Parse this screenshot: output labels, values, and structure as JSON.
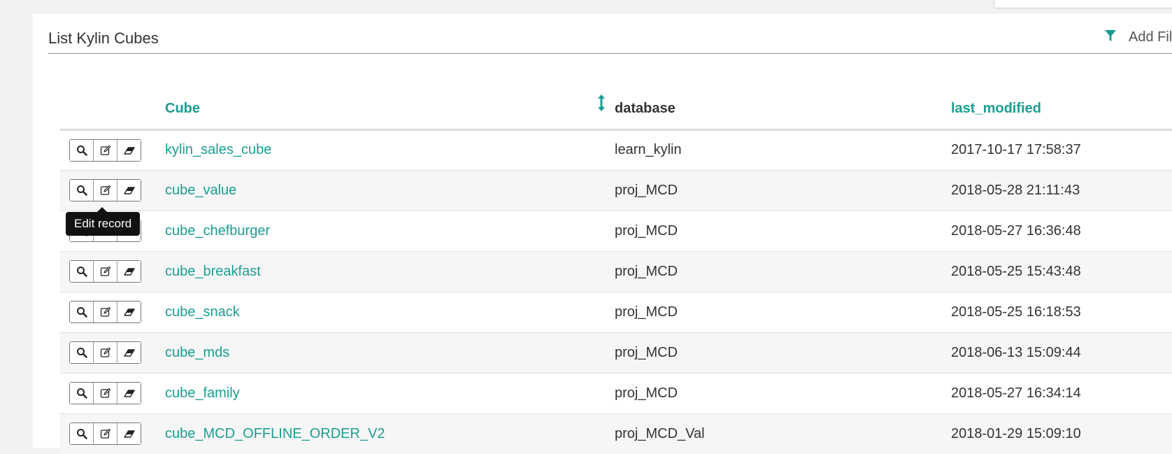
{
  "panel": {
    "title": "List Kylin Cubes",
    "add_filter_label": "Add Filter",
    "accent_color": "#1a9e92"
  },
  "table": {
    "columns": {
      "cube": "Cube",
      "database": "database",
      "last_modified": "last_modified"
    },
    "action_icons": [
      "search-icon",
      "edit-icon",
      "eraser-icon"
    ],
    "rows": [
      {
        "cube": "kylin_sales_cube",
        "database": "learn_kylin",
        "last_modified": "2017-10-17 17:58:37"
      },
      {
        "cube": "cube_value",
        "database": "proj_MCD",
        "last_modified": "2018-05-28 21:11:43"
      },
      {
        "cube": "cube_chefburger",
        "database": "proj_MCD",
        "last_modified": "2018-05-27 16:36:48"
      },
      {
        "cube": "cube_breakfast",
        "database": "proj_MCD",
        "last_modified": "2018-05-25 15:43:48"
      },
      {
        "cube": "cube_snack",
        "database": "proj_MCD",
        "last_modified": "2018-05-25 16:18:53"
      },
      {
        "cube": "cube_mds",
        "database": "proj_MCD",
        "last_modified": "2018-06-13 15:09:44"
      },
      {
        "cube": "cube_family",
        "database": "proj_MCD",
        "last_modified": "2018-05-27 16:34:14"
      },
      {
        "cube": "cube_MCD_OFFLINE_ORDER_V2",
        "database": "proj_MCD_Val",
        "last_modified": "2018-01-29 15:09:10"
      }
    ]
  },
  "tooltip": {
    "text": "Edit record"
  }
}
